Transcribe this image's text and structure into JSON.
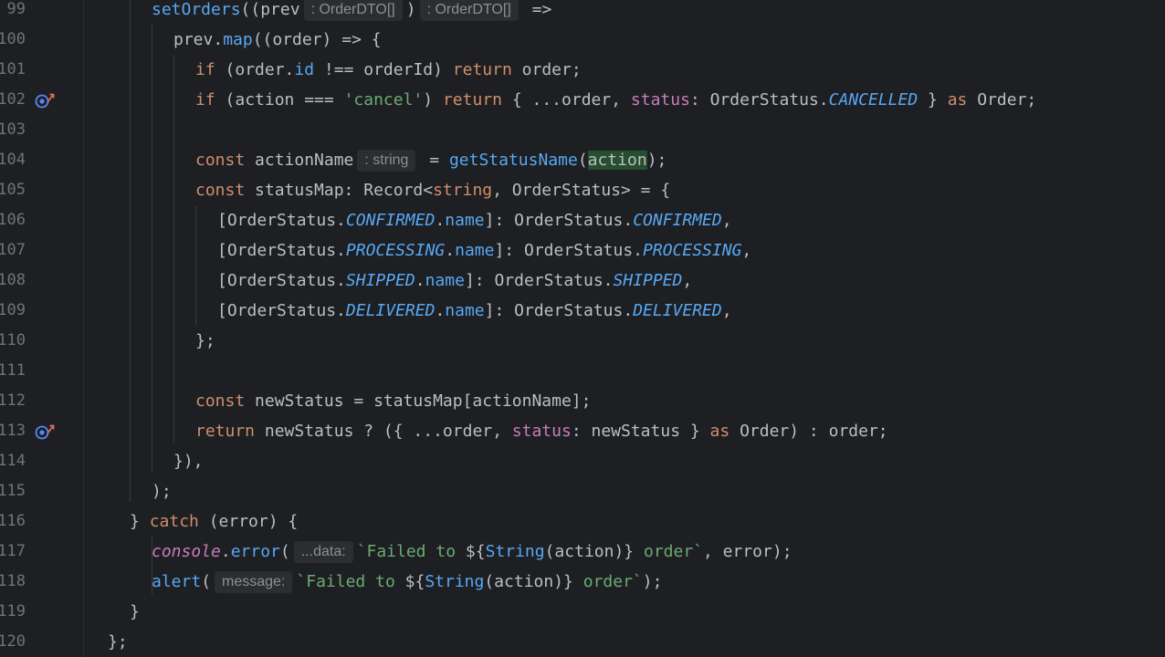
{
  "line_numbers": [
    "99",
    "100",
    "101",
    "102",
    "103",
    "104",
    "105",
    "106",
    "107",
    "108",
    "109",
    "110",
    "111",
    "112",
    "113",
    "114",
    "115",
    "116",
    "117",
    "118",
    "119",
    "120"
  ],
  "gutter_icons": {
    "line_102": "override-marker-icon",
    "line_113": "override-marker-icon"
  },
  "code": {
    "l99": {
      "fn": "setOrders",
      "p1": "((prev",
      "hint1": ": OrderDTO[]",
      "p2": ")",
      "hint2": ": OrderDTO[]",
      "p3": " =>"
    },
    "l100": {
      "p1": "prev.",
      "fn": "map",
      "p2": "((order) => {"
    },
    "l101": {
      "kw1": "if",
      "p1": " (order.",
      "fld": "id",
      "p2": " !== orderId) ",
      "kw2": "return",
      "p3": " order;"
    },
    "l102": {
      "kw1": "if",
      "p1": " (action === ",
      "str": "'cancel'",
      "p2": ") ",
      "kw2": "return",
      "p3": " { ...order, ",
      "prop": "status",
      "p4": ": OrderStatus.",
      "const": "CANCELLED",
      "p5": " } ",
      "kw3": "as",
      "p6": " Order;"
    },
    "l104": {
      "kw": "const",
      "p1": " actionName",
      "hint": ": string",
      "p2": " = ",
      "fn": "getStatusName",
      "p3": "(",
      "hl": "action",
      "p4": ");"
    },
    "l105": {
      "kw": "const",
      "p1": " statusMap: Record<",
      "kw2": "string",
      "p2": ", OrderStatus> = {"
    },
    "l106": {
      "p1": "[OrderStatus.",
      "c1": "CONFIRMED",
      "p2": ".",
      "fld": "name",
      "p3": "]: OrderStatus.",
      "c2": "CONFIRMED",
      "p4": ","
    },
    "l107": {
      "p1": "[OrderStatus.",
      "c1": "PROCESSING",
      "p2": ".",
      "fld": "name",
      "p3": "]: OrderStatus.",
      "c2": "PROCESSING",
      "p4": ","
    },
    "l108": {
      "p1": "[OrderStatus.",
      "c1": "SHIPPED",
      "p2": ".",
      "fld": "name",
      "p3": "]: OrderStatus.",
      "c2": "SHIPPED",
      "p4": ","
    },
    "l109": {
      "p1": "[OrderStatus.",
      "c1": "DELIVERED",
      "p2": ".",
      "fld": "name",
      "p3": "]: OrderStatus.",
      "c2": "DELIVERED",
      "p4": ","
    },
    "l110": {
      "p1": "};"
    },
    "l112": {
      "kw": "const",
      "p1": " newStatus = statusMap[actionName];"
    },
    "l113": {
      "kw": "return",
      "p1": " newStatus ? ({ ...order, ",
      "prop": "status",
      "p2": ": newStatus } ",
      "kw2": "as",
      "p3": " Order) : order;"
    },
    "l114": {
      "p1": "}),"
    },
    "l115": {
      "p1": ");"
    },
    "l116": {
      "p1": "} ",
      "kw": "catch",
      "p2": " (error) {"
    },
    "l117": {
      "glob": "console",
      "p1": ".",
      "fn": "error",
      "p2": "(",
      "hint": "...data:",
      "str1": "`Failed to ",
      "p3": "${",
      "fn2": "String",
      "p4": "(action)}",
      "str2": " order`",
      "p5": ", error);"
    },
    "l118": {
      "fn": "alert",
      "p1": "(",
      "hint": "message:",
      "str1": "`Failed to ",
      "p2": "${",
      "fn2": "String",
      "p3": "(action)}",
      "str2": " order`",
      "p4": ");"
    },
    "l119": {
      "p1": "}"
    },
    "l120": {
      "p1": "};"
    }
  },
  "colors": {
    "background": "#1e1f22",
    "keyword": "#cf8e6d",
    "function": "#56a8f5",
    "string": "#6aab73",
    "property": "#c77dbb",
    "text": "#bcbec4",
    "line_number": "#6f737a"
  }
}
